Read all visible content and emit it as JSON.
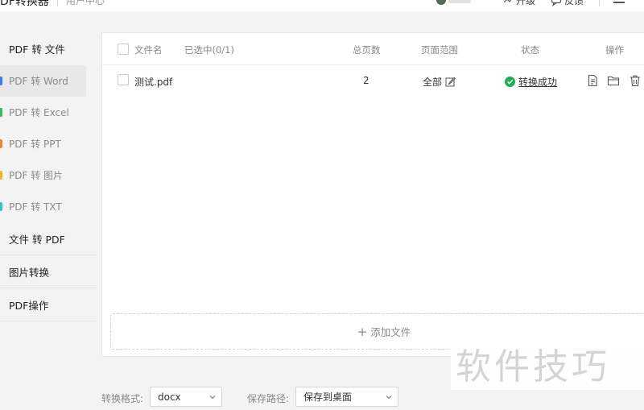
{
  "topbar": {
    "app_title": "DF转换器",
    "user_center": "用户中心",
    "upgrade": "升级",
    "feedback": "反馈"
  },
  "sidebar": {
    "groups": [
      {
        "label": "PDF 转 文件"
      },
      {
        "label": "文件 转 PDF"
      },
      {
        "label": "图片转换"
      },
      {
        "label": "PDF操作"
      }
    ],
    "items": [
      {
        "label": "PDF 转 Word",
        "color": "#3a7cf5",
        "active": true
      },
      {
        "label": "PDF 转 Excel",
        "color": "#2fbf5b"
      },
      {
        "label": "PDF 转 PPT",
        "color": "#f0862a"
      },
      {
        "label": "PDF 转 图片",
        "color": "#f3b12c"
      },
      {
        "label": "PDF 转 TXT",
        "color": "#2cc8c8"
      }
    ]
  },
  "table": {
    "headers": {
      "filename": "文件名",
      "selected": "已选中(0/1)",
      "pages": "总页数",
      "range": "页面范围",
      "status": "状态",
      "actions": "操作"
    },
    "rows": [
      {
        "name": "测试.pdf",
        "pages": "2",
        "range": "全部",
        "status": "转换成功"
      }
    ]
  },
  "add_file": "添加文件",
  "watermark": "软件技巧",
  "bottom": {
    "format_label": "转换格式:",
    "format_value": "docx",
    "path_label": "保存路径:",
    "path_value": "保存到桌面"
  },
  "colors": {
    "success": "#1fae52"
  },
  "icons": [
    "upgrade-icon",
    "feedback-icon",
    "edit-icon",
    "check-icon",
    "file-icon",
    "folder-icon",
    "trash-icon",
    "chevron-down-icon",
    "plus-icon"
  ]
}
